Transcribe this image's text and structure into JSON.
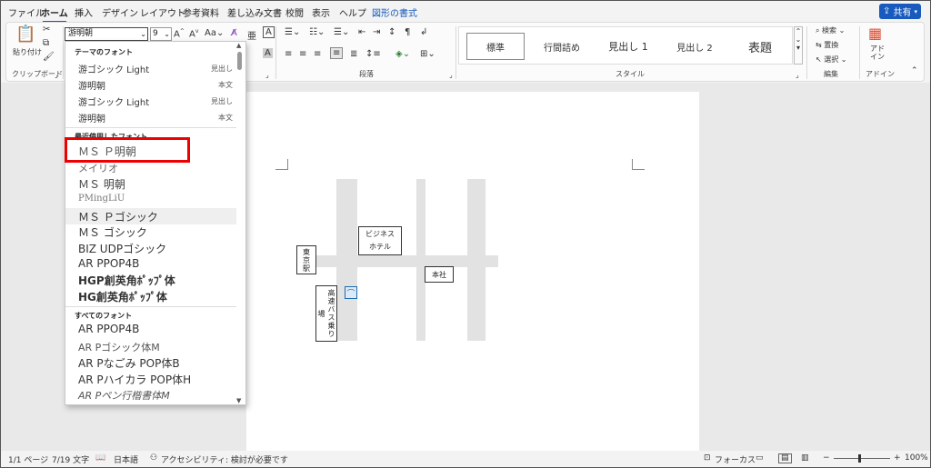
{
  "tabs": [
    "ファイル",
    "ホーム",
    "挿入",
    "デザイン",
    "レイアウト",
    "参考資料",
    "差し込み文書",
    "校閲",
    "表示",
    "ヘルプ",
    "図形の書式"
  ],
  "share_label": "共有",
  "ribbon": {
    "paste_label": "貼り付け",
    "clipboard_label": "クリップボード",
    "font_name": "游明朝",
    "font_size": "9",
    "paragraph_label": "段落",
    "style_label": "スタイル",
    "styles": [
      "標準",
      "行間詰め",
      "見出し 1",
      "見出し 2",
      "表題"
    ],
    "edit_label": "編集",
    "find_label": "検索",
    "replace_label": "置換",
    "select_label": "選択",
    "addin_label": "アドイン",
    "addin_button": "アド\nイン"
  },
  "dropdown": {
    "theme_header": "テーマのフォント",
    "theme_fonts": [
      {
        "name": "游ゴシック Light",
        "tag": "見出し"
      },
      {
        "name": "游明朝",
        "tag": "本文"
      },
      {
        "name": "游ゴシック Light",
        "tag": "見出し"
      },
      {
        "name": "游明朝",
        "tag": "本文"
      }
    ],
    "recent_header": "最近使用したフォント",
    "recent_fonts": [
      "ＭＳ Ｐ明朝",
      "メイリオ",
      "ＭＳ 明朝",
      "PMingLiU",
      "ＭＳ Ｐゴシック",
      "ＭＳ ゴシック",
      "BIZ UDPゴシック",
      "AR PPOP4B",
      "HGP創英角ﾎﾟｯﾌﾟ体",
      "HG創英角ﾎﾟｯﾌﾟ体"
    ],
    "all_header": "すべてのフォント",
    "all_fonts": [
      "AR PPOP4B",
      "AR Pゴシック体M",
      "AR Pなごみ POP体B",
      "AR Pハイカラ POP体H",
      "AR Pペン行楷書体M"
    ]
  },
  "map": {
    "business_hotel": "ビジネス\nホテル",
    "tokyo_station": "東京駅",
    "head_office": "本社",
    "bus_stop": "高速バス乗り場"
  },
  "status": {
    "page": "1/1 ページ",
    "words": "7/19 文字",
    "language": "日本語",
    "accessibility": "アクセシビリティ: 検討が必要です",
    "focus": "フォーカス",
    "zoom": "100%"
  },
  "colors": {
    "accent": "#185abd",
    "highlight": "#e00000"
  }
}
